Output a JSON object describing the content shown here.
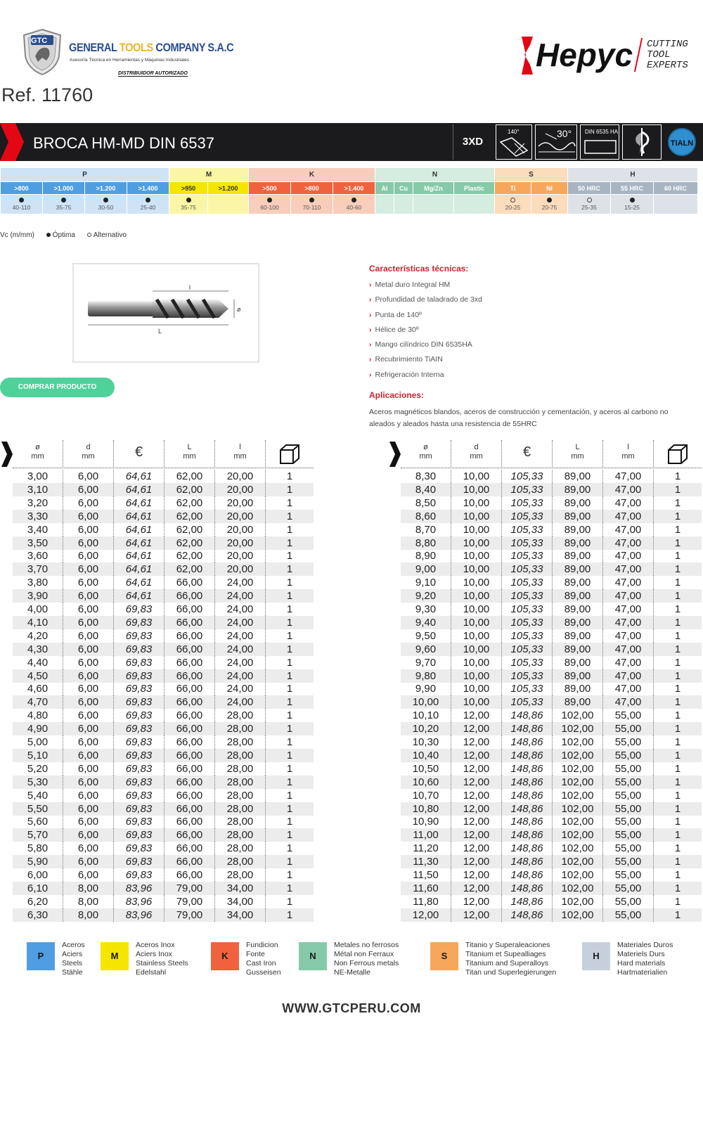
{
  "header": {
    "gtc_badge": "GTC",
    "company_w1": "GENERAL",
    "company_w2": "TOOLS",
    "company_w3": "COMPANY S.A.C",
    "subtitle": "Asesoría Técnica en Herramientas y Máquinas Industriales",
    "distributor": "DISTRIBUIDOR AUTORIZADO",
    "brand": "Hepyc",
    "brand_tag": [
      "CUTTING",
      "TOOL",
      "EXPERTS"
    ],
    "ref": "Ref. 11760"
  },
  "band": {
    "title": "BROCA HM-MD DIN 6537",
    "features": {
      "ratio": "3XD",
      "point_angle": "140°",
      "helix": "30°",
      "shank": "DIN 6535 HA",
      "coating": "TIALN"
    }
  },
  "materials": {
    "groups": [
      {
        "code": "P",
        "color": "#4f9ee1",
        "light": "#cfe3f6",
        "sub": [
          ">800",
          ">1.000",
          ">1.200",
          ">1.400"
        ],
        "marks": [
          "dot",
          "dot",
          "dot",
          "dot"
        ],
        "vals": [
          "40-110",
          "35-75",
          "30-50",
          "25-40"
        ]
      },
      {
        "code": "M",
        "color": "#f5e600",
        "light": "#fbf6a7",
        "sub": [
          ">950",
          ">1.200"
        ],
        "marks": [
          "dot",
          ""
        ],
        "vals": [
          "35-75",
          ""
        ]
      },
      {
        "code": "K",
        "color": "#f0623d",
        "light": "#f9cdbc",
        "sub": [
          ">500",
          ">800",
          ">1.400"
        ],
        "marks": [
          "dot",
          "dot",
          "dot"
        ],
        "vals": [
          "60-100",
          "70-110",
          "40-60"
        ]
      },
      {
        "code": "N",
        "color": "#86c9a9",
        "light": "#d5ece0",
        "sub": [
          "Al",
          "Cu",
          "Mg/Zn",
          "Plastic"
        ],
        "marks": [
          "",
          "",
          "",
          ""
        ],
        "vals": [
          "",
          "",
          "",
          ""
        ]
      },
      {
        "code": "S",
        "color": "#f6a75c",
        "light": "#fbdcbb",
        "sub": [
          "Ti",
          "Ni"
        ],
        "marks": [
          "odot",
          "dot"
        ],
        "vals": [
          "20-25",
          "20-75"
        ]
      },
      {
        "code": "H",
        "color": "#a8b4c2",
        "light": "#dde2e8",
        "sub": [
          "50 HRC",
          "55 HRC",
          "60 HRC"
        ],
        "marks": [
          "odot",
          "dot",
          ""
        ],
        "vals": [
          "25-35",
          "15-25",
          ""
        ]
      }
    ],
    "legend": {
      "vc": "Vc (m/mm)",
      "optima": "Óptima",
      "alternativo": "Alternativo"
    }
  },
  "drill": {
    "label_l_small": "l",
    "label_L": "L",
    "label_d": "ø"
  },
  "buy_button": "COMPRAR PRODUCTO",
  "specs": {
    "title": "Características técnicas:",
    "items": [
      "Metal duro Integral HM",
      "Profundidad de taladrado de 3xd",
      "Punta de 140º",
      "Hélice de 30º",
      "Mango cilíndrico DIN 6535HA",
      "Recubrimiento TiAIN",
      "Refrigeración Interna"
    ],
    "app_title": "Aplicaciones:",
    "app_text": "Aceros magnéticos blandos, aceros de construcción y cementación, y aceros al carbono no aleados y aleados hasta una resistencia de 55HRC"
  },
  "table": {
    "headers": [
      {
        "top": "ø",
        "bottom": "mm"
      },
      {
        "top": "d",
        "bottom": "mm"
      },
      {
        "top": "€",
        "bottom": ""
      },
      {
        "top": "L",
        "bottom": "mm"
      },
      {
        "top": "l",
        "bottom": "mm"
      },
      {
        "top": "",
        "bottom": ""
      }
    ],
    "left": [
      [
        "3,00",
        "6,00",
        "64,61",
        "62,00",
        "20,00",
        "1"
      ],
      [
        "3,10",
        "6,00",
        "64,61",
        "62,00",
        "20,00",
        "1"
      ],
      [
        "3,20",
        "6,00",
        "64,61",
        "62,00",
        "20,00",
        "1"
      ],
      [
        "3,30",
        "6,00",
        "64,61",
        "62,00",
        "20,00",
        "1"
      ],
      [
        "3,40",
        "6,00",
        "64,61",
        "62,00",
        "20,00",
        "1"
      ],
      [
        "3,50",
        "6,00",
        "64,61",
        "62,00",
        "20,00",
        "1"
      ],
      [
        "3,60",
        "6,00",
        "64,61",
        "62,00",
        "20,00",
        "1"
      ],
      [
        "3,70",
        "6,00",
        "64,61",
        "62,00",
        "20,00",
        "1"
      ],
      [
        "3,80",
        "6,00",
        "64,61",
        "66,00",
        "24,00",
        "1"
      ],
      [
        "3,90",
        "6,00",
        "64,61",
        "66,00",
        "24,00",
        "1"
      ],
      [
        "4,00",
        "6,00",
        "69,83",
        "66,00",
        "24,00",
        "1"
      ],
      [
        "4,10",
        "6,00",
        "69,83",
        "66,00",
        "24,00",
        "1"
      ],
      [
        "4,20",
        "6,00",
        "69,83",
        "66,00",
        "24,00",
        "1"
      ],
      [
        "4,30",
        "6,00",
        "69,83",
        "66,00",
        "24,00",
        "1"
      ],
      [
        "4,40",
        "6,00",
        "69,83",
        "66,00",
        "24,00",
        "1"
      ],
      [
        "4,50",
        "6,00",
        "69,83",
        "66,00",
        "24,00",
        "1"
      ],
      [
        "4,60",
        "6,00",
        "69,83",
        "66,00",
        "24,00",
        "1"
      ],
      [
        "4,70",
        "6,00",
        "69,83",
        "66,00",
        "24,00",
        "1"
      ],
      [
        "4,80",
        "6,00",
        "69,83",
        "66,00",
        "28,00",
        "1"
      ],
      [
        "4,90",
        "6,00",
        "69,83",
        "66,00",
        "28,00",
        "1"
      ],
      [
        "5,00",
        "6,00",
        "69,83",
        "66,00",
        "28,00",
        "1"
      ],
      [
        "5,10",
        "6,00",
        "69,83",
        "66,00",
        "28,00",
        "1"
      ],
      [
        "5,20",
        "6,00",
        "69,83",
        "66,00",
        "28,00",
        "1"
      ],
      [
        "5,30",
        "6,00",
        "69,83",
        "66,00",
        "28,00",
        "1"
      ],
      [
        "5,40",
        "6,00",
        "69,83",
        "66,00",
        "28,00",
        "1"
      ],
      [
        "5,50",
        "6,00",
        "69,83",
        "66,00",
        "28,00",
        "1"
      ],
      [
        "5,60",
        "6,00",
        "69,83",
        "66,00",
        "28,00",
        "1"
      ],
      [
        "5,70",
        "6,00",
        "69,83",
        "66,00",
        "28,00",
        "1"
      ],
      [
        "5,80",
        "6,00",
        "69,83",
        "66,00",
        "28,00",
        "1"
      ],
      [
        "5,90",
        "6,00",
        "69,83",
        "66,00",
        "28,00",
        "1"
      ],
      [
        "6,00",
        "6,00",
        "69,83",
        "66,00",
        "28,00",
        "1"
      ],
      [
        "6,10",
        "8,00",
        "83,96",
        "79,00",
        "34,00",
        "1"
      ],
      [
        "6,20",
        "8,00",
        "83,96",
        "79,00",
        "34,00",
        "1"
      ],
      [
        "6,30",
        "8,00",
        "83,96",
        "79,00",
        "34,00",
        "1"
      ]
    ],
    "right": [
      [
        "8,30",
        "10,00",
        "105,33",
        "89,00",
        "47,00",
        "1"
      ],
      [
        "8,40",
        "10,00",
        "105,33",
        "89,00",
        "47,00",
        "1"
      ],
      [
        "8,50",
        "10,00",
        "105,33",
        "89,00",
        "47,00",
        "1"
      ],
      [
        "8,60",
        "10,00",
        "105,33",
        "89,00",
        "47,00",
        "1"
      ],
      [
        "8,70",
        "10,00",
        "105,33",
        "89,00",
        "47,00",
        "1"
      ],
      [
        "8,80",
        "10,00",
        "105,33",
        "89,00",
        "47,00",
        "1"
      ],
      [
        "8,90",
        "10,00",
        "105,33",
        "89,00",
        "47,00",
        "1"
      ],
      [
        "9,00",
        "10,00",
        "105,33",
        "89,00",
        "47,00",
        "1"
      ],
      [
        "9,10",
        "10,00",
        "105,33",
        "89,00",
        "47,00",
        "1"
      ],
      [
        "9,20",
        "10,00",
        "105,33",
        "89,00",
        "47,00",
        "1"
      ],
      [
        "9,30",
        "10,00",
        "105,33",
        "89,00",
        "47,00",
        "1"
      ],
      [
        "9,40",
        "10,00",
        "105,33",
        "89,00",
        "47,00",
        "1"
      ],
      [
        "9,50",
        "10,00",
        "105,33",
        "89,00",
        "47,00",
        "1"
      ],
      [
        "9,60",
        "10,00",
        "105,33",
        "89,00",
        "47,00",
        "1"
      ],
      [
        "9,70",
        "10,00",
        "105,33",
        "89,00",
        "47,00",
        "1"
      ],
      [
        "9,80",
        "10,00",
        "105,33",
        "89,00",
        "47,00",
        "1"
      ],
      [
        "9,90",
        "10,00",
        "105,33",
        "89,00",
        "47,00",
        "1"
      ],
      [
        "10,00",
        "10,00",
        "105,33",
        "89,00",
        "47,00",
        "1"
      ],
      [
        "10,10",
        "12,00",
        "148,86",
        "102,00",
        "55,00",
        "1"
      ],
      [
        "10,20",
        "12,00",
        "148,86",
        "102,00",
        "55,00",
        "1"
      ],
      [
        "10,30",
        "12,00",
        "148,86",
        "102,00",
        "55,00",
        "1"
      ],
      [
        "10,40",
        "12,00",
        "148,86",
        "102,00",
        "55,00",
        "1"
      ],
      [
        "10,50",
        "12,00",
        "148,86",
        "102,00",
        "55,00",
        "1"
      ],
      [
        "10,60",
        "12,00",
        "148,86",
        "102,00",
        "55,00",
        "1"
      ],
      [
        "10,70",
        "12,00",
        "148,86",
        "102,00",
        "55,00",
        "1"
      ],
      [
        "10,80",
        "12,00",
        "148,86",
        "102,00",
        "55,00",
        "1"
      ],
      [
        "10,90",
        "12,00",
        "148,86",
        "102,00",
        "55,00",
        "1"
      ],
      [
        "11,00",
        "12,00",
        "148,86",
        "102,00",
        "55,00",
        "1"
      ],
      [
        "11,20",
        "12,00",
        "148,86",
        "102,00",
        "55,00",
        "1"
      ],
      [
        "11,30",
        "12,00",
        "148,86",
        "102,00",
        "55,00",
        "1"
      ],
      [
        "11,50",
        "12,00",
        "148,86",
        "102,00",
        "55,00",
        "1"
      ],
      [
        "11,60",
        "12,00",
        "148,86",
        "102,00",
        "55,00",
        "1"
      ],
      [
        "11,80",
        "12,00",
        "148,86",
        "102,00",
        "55,00",
        "1"
      ],
      [
        "12,00",
        "12,00",
        "148,86",
        "102,00",
        "55,00",
        "1"
      ]
    ]
  },
  "material_legend": [
    {
      "code": "P",
      "color": "#4f9ee1",
      "text_color": "#1b1a1c",
      "lines": [
        "Aceros",
        "Aciers",
        "Steels",
        "Stähle"
      ]
    },
    {
      "code": "M",
      "color": "#f5e600",
      "text_color": "#1b1a1c",
      "lines": [
        "Aceros Inox",
        "Aciers Inox",
        "Stainless Steels",
        "Edelstahl"
      ]
    },
    {
      "code": "K",
      "color": "#f0623d",
      "text_color": "#1b1a1c",
      "lines": [
        "Fundicion",
        "Fonte",
        "Cast Iron",
        "Gusseisen"
      ]
    },
    {
      "code": "N",
      "color": "#86c9a9",
      "text_color": "#1b1a1c",
      "lines": [
        "Metales no ferrosos",
        "Métal non Ferraux",
        "Non Ferrous metals",
        "NE-Metalle"
      ]
    },
    {
      "code": "S",
      "color": "#f6a75c",
      "text_color": "#1b1a1c",
      "lines": [
        "Titanio y Superaleaciones",
        "Titanium et Supealliages",
        "Titanium and Superalloys",
        "Titan und Superlegierungen"
      ]
    },
    {
      "code": "H",
      "color": "#c7d0da",
      "text_color": "#1b1a1c",
      "lines": [
        "Materiales Duros",
        "Materiels Durs",
        "Hard materials",
        "Hartmaterialien"
      ]
    }
  ],
  "footer": {
    "website": "WWW.GTCPERU.COM"
  }
}
